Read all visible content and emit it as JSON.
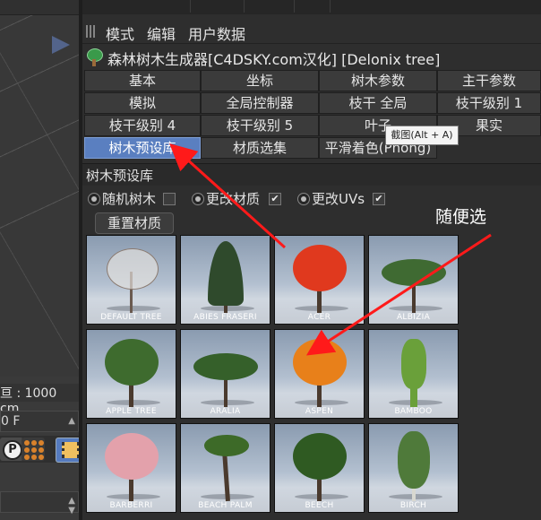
{
  "viewport": {
    "distance_text": "亘 : 1000 cm",
    "frame_value": "0 F",
    "tool_icons": [
      "p-key-icon",
      "dots-grid-icon",
      "film-strip-icon"
    ]
  },
  "menu": {
    "items": [
      "模式",
      "编辑",
      "用户数据"
    ]
  },
  "title": "森林树木生成器[C4DSKY.com汉化] [Delonix tree]",
  "tabs": [
    [
      "基本",
      "坐标",
      "树木参数",
      "主干参数"
    ],
    [
      "模拟",
      "全局控制器",
      "枝干 全局",
      "枝干级别 1"
    ],
    [
      "枝干级别 4",
      "枝干级别 5",
      "叶子",
      "果实"
    ],
    [
      "树木预设库",
      "材质选集",
      "平滑着色(Phong)"
    ]
  ],
  "active_tab": "树木预设库",
  "tooltip": "截图(Alt + A)",
  "section_title": "树木预设库",
  "options": {
    "random_tree": "随机树木",
    "change_material": "更改材质",
    "change_uvs": "更改UVs",
    "change_material_check": "✔",
    "change_uvs_check": "✔"
  },
  "reset_button": "重置材质",
  "annotation": "随便选",
  "presets": [
    {
      "label": "DEFAULT TREE",
      "icon": "bare-tree-icon",
      "color": "#c8c6c2"
    },
    {
      "label": "ABIES FRASERI",
      "icon": "conifer-icon",
      "color": "#2f4a2c"
    },
    {
      "label": "ACER",
      "icon": "red-tree-icon",
      "color": "#e0391e"
    },
    {
      "label": "ALBIZIA",
      "icon": "spread-tree-icon",
      "color": "#3f6a32"
    },
    {
      "label": "APPLE TREE",
      "icon": "round-tree-icon",
      "color": "#3e6b2e"
    },
    {
      "label": "ARALIA",
      "icon": "spread-tree-icon",
      "color": "#35602a"
    },
    {
      "label": "ASPEN",
      "icon": "orange-tree-icon",
      "color": "#e8801a"
    },
    {
      "label": "BAMBOO",
      "icon": "bamboo-icon",
      "color": "#6aa03a"
    },
    {
      "label": "BARBERRI",
      "icon": "pink-tree-icon",
      "color": "#e3a1ab"
    },
    {
      "label": "BEACH PALM",
      "icon": "palm-icon",
      "color": "#3d6a28"
    },
    {
      "label": "BEECH",
      "icon": "round-tree-icon",
      "color": "#2f5a22"
    },
    {
      "label": "BIRCH",
      "icon": "birch-icon",
      "color": "#4f7a3a"
    }
  ],
  "colors": {
    "active_tab": "#5a7fc0",
    "annotation_arrow": "#ff1a1a",
    "panel_bg": "#2e2e2e"
  }
}
